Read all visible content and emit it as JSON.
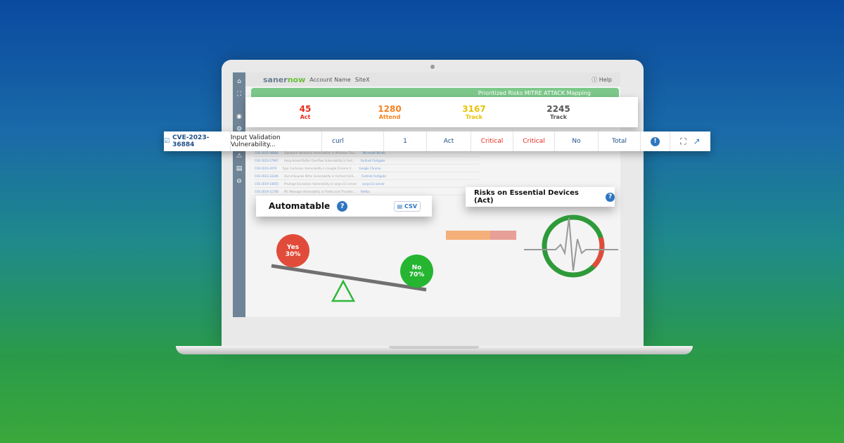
{
  "app": {
    "logo_main": "saner",
    "logo_accent": "now",
    "account_label": "Account Name",
    "site": "SiteX",
    "help": "Help",
    "green_tabs": "Prioritized Risks     MITRE ATTACK Mapping"
  },
  "sidebar": {
    "icons": [
      "home-icon",
      "network-icon",
      "eye-icon",
      "gear-icon",
      "warning-icon",
      "clipboard-icon",
      "logout-icon"
    ]
  },
  "stats": [
    {
      "value": "45",
      "label": "Act",
      "color": "#e8291c"
    },
    {
      "value": "1280",
      "label": "Attend",
      "color": "#f58220"
    },
    {
      "value": "3167",
      "label": "Track",
      "color": "#e6c200"
    },
    {
      "value": "2245",
      "label": "Track",
      "color": "#555555"
    }
  ],
  "highlight_row": {
    "cve": "CVE-2023-36884",
    "title": "Input Validation Vulnerability...",
    "product": "curl",
    "count": "1",
    "action": "Act",
    "severity1": "Critical",
    "severity2": "Critical",
    "automatable": "No",
    "impact": "Total"
  },
  "bg_rows": [
    {
      "cve": "CVE-2023-36884",
      "title": "Signature Validation Vulnerability in Windows Trus...",
      "product": "Microsoft Windo"
    },
    {
      "cve": "CVE-2023-27997",
      "title": "Heap-based Buffer Overflow Vulnerability in Fort...",
      "product": "Fortinet Fortigate"
    },
    {
      "cve": "CVE-2023-3079",
      "title": "Type Confusion Vulnerability in Google Chrome V...",
      "product": "Google Chrome"
    },
    {
      "cve": "CVE-2023-33246",
      "title": "Out-of-bounds Write Vulnerability in Fortinet Forti...",
      "product": "Fortinet Fortigate"
    },
    {
      "cve": "CVE-2019-14855",
      "title": "Privilege Escalation Vulnerability in xorg-x11-server",
      "product": "xorg-x11-server"
    },
    {
      "cve": "CVE-2019-11708",
      "title": "IPC Message Vulnerability in Firefox and Thunder...",
      "product": "firefox"
    }
  ],
  "automatable": {
    "title": "Automatable",
    "csv": "CSV",
    "yes_label": "Yes",
    "yes_pct": "30%",
    "no_label": "No",
    "no_pct": "70%",
    "yes_value": 30,
    "no_value": 70
  },
  "essential": {
    "title": "Risks on Essential Devices (Act)"
  },
  "colors": {
    "green": "#2fa83a",
    "red": "#e14c3a",
    "blue": "#2e75c0"
  }
}
